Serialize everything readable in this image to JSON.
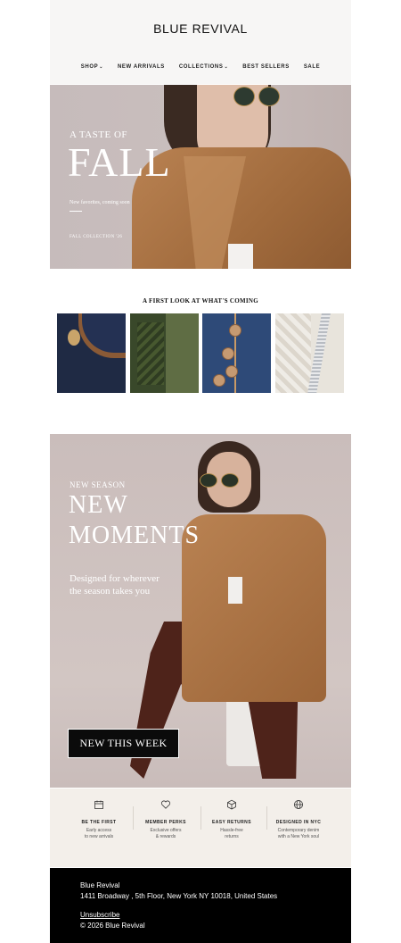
{
  "header": {
    "brand": "BLUE REVIVAL",
    "nav": [
      {
        "label": "SHOP",
        "has_dropdown": true
      },
      {
        "label": "NEW ARRIVALS",
        "has_dropdown": false
      },
      {
        "label": "COLLECTIONS",
        "has_dropdown": true
      },
      {
        "label": "BEST SELLERS",
        "has_dropdown": false
      },
      {
        "label": "SALE",
        "has_dropdown": false
      }
    ]
  },
  "hero_fall": {
    "kicker": "A TASTE OF",
    "title": "FALL",
    "subtitle": "New favorites, coming soon",
    "tag": "FALL COLLECTION '26"
  },
  "first_look": {
    "title": "A FIRST LOOK AT WHAT'S COMING",
    "tiles": [
      "denim-button-detail",
      "green-knit-detail",
      "denim-buttons-detail",
      "cream-knit-zipper-detail"
    ]
  },
  "hero_new": {
    "kicker": "NEW SEASON",
    "title_line1": "NEW",
    "title_line2": "MOMENTS",
    "sub_line1": "Designed for wherever",
    "sub_line2": "the season takes you",
    "cta_label": "NEW THIS WEEK"
  },
  "perks": [
    {
      "icon": "calendar-icon",
      "title": "BE THE FIRST",
      "line1": "Early access",
      "line2": "to new arrivals"
    },
    {
      "icon": "heart-icon",
      "title": "MEMBER PERKS",
      "line1": "Exclusive offers",
      "line2": "& rewards"
    },
    {
      "icon": "box-icon",
      "title": "EASY RETURNS",
      "line1": "Hassle-free",
      "line2": "returns"
    },
    {
      "icon": "globe-icon",
      "title": "DESIGNED IN NYC",
      "line1": "Contemporary denim",
      "line2": "with a New York soul"
    }
  ],
  "footer": {
    "company": "Blue Revival",
    "address": "1411 Broadway , 5th Floor, New York NY 10018, United States",
    "unsubscribe": "Unsubscribe",
    "copyright": "© 2026 Blue Revival"
  },
  "colors": {
    "header_bg": "#f7f6f5",
    "hero_bg": "#c8bcbb",
    "perks_bg": "#f3efea",
    "footer_bg": "#000000",
    "cta_bg": "#0b0b0b"
  }
}
